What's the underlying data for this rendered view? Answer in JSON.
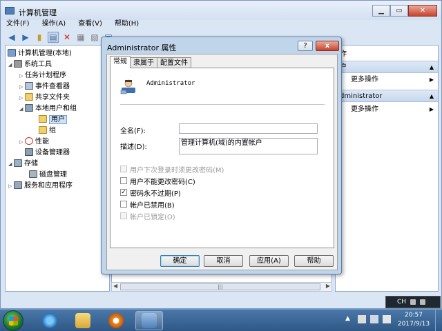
{
  "window": {
    "title": "计算机管理"
  },
  "menu": [
    "文件(F)",
    "操作(A)",
    "查看(V)",
    "帮助(H)"
  ],
  "tree": {
    "items": [
      {
        "label": "计算机管理(本地)",
        "expander": "",
        "icon": "computer-icon"
      },
      {
        "label": "系统工具",
        "expander": "◢",
        "icon": "tools-icon"
      },
      {
        "label": "任务计划程序",
        "expander": "▷",
        "icon": "clock-icon"
      },
      {
        "label": "事件查看器",
        "expander": "▷",
        "icon": "event-viewer-icon"
      },
      {
        "label": "共享文件夹",
        "expander": "▷",
        "icon": "shared-folder-icon"
      },
      {
        "label": "本地用户和组",
        "expander": "◢",
        "icon": "users-icon"
      },
      {
        "label": "用户",
        "expander": "",
        "icon": "folder-icon"
      },
      {
        "label": "组",
        "expander": "",
        "icon": "folder-icon"
      },
      {
        "label": "性能",
        "expander": "▷",
        "icon": "performance-icon"
      },
      {
        "label": "设备管理器",
        "expander": "",
        "icon": "device-manager-icon"
      },
      {
        "label": "存储",
        "expander": "◢",
        "icon": "storage-icon"
      },
      {
        "label": "磁盘管理",
        "expander": "",
        "icon": "disk-icon"
      },
      {
        "label": "服务和应用程序",
        "expander": "▷",
        "icon": "services-icon"
      }
    ]
  },
  "actions": {
    "header": "作",
    "group1": "户",
    "more1": "更多操作",
    "group2": "dministrator",
    "more2": "更多操作"
  },
  "dialog": {
    "title": "Administrator 属性",
    "help": "?",
    "close": "x",
    "tabs": [
      "常规",
      "隶属于",
      "配置文件"
    ],
    "username": "Administrator",
    "fullname_label": "全名(F):",
    "fullname_value": "",
    "description_label": "描述(D):",
    "description_value": "管理计算机(域)的内置帐户",
    "checks": [
      {
        "label": "用户下次登录时须更改密码(M)",
        "checked": false,
        "disabled": true
      },
      {
        "label": "用户不能更改密码(C)",
        "checked": false,
        "disabled": false
      },
      {
        "label": "密码永不过期(P)",
        "checked": true,
        "disabled": false
      },
      {
        "label": "帐户已禁用(B)",
        "checked": false,
        "disabled": false
      },
      {
        "label": "帐户已锁定(O)",
        "checked": false,
        "disabled": true
      }
    ],
    "buttons": {
      "ok": "确定",
      "cancel": "取消",
      "apply": "应用(A)",
      "help": "帮助"
    }
  },
  "langbar": {
    "lang": "CH"
  },
  "taskbar": {
    "time": "20:57",
    "date": "2017/9/13"
  },
  "colors": {
    "accent": "#5b8fbf",
    "dialog_frame": "#c0d4ea"
  }
}
